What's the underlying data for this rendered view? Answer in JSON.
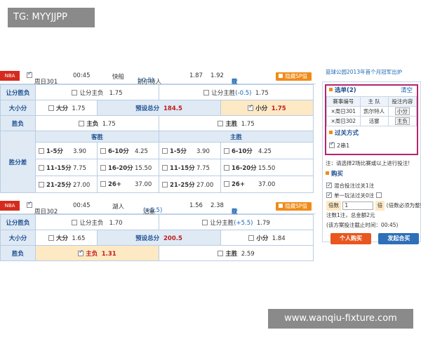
{
  "watermarks": {
    "top": "TG: MYYJJPP",
    "bottom": "www.wanqiu-fixture.com"
  },
  "game1": {
    "league": "NBA",
    "code": "周日301",
    "time": "00:45",
    "away": "快船",
    "home": "凯尔特人",
    "handicap": "(-0.5)",
    "odds1": "1.87",
    "odds2": "1.92",
    "analysis": "析",
    "stats": "欧",
    "trend": "亚",
    "hide_sp": "隐藏SP值",
    "rows": {
      "hcp_label": "让分胜负",
      "hcp_away": "让分主负",
      "hcp_away_odds": "1.75",
      "hcp_home": "让分主胜",
      "hcp_home_line": "(-0.5)",
      "hcp_home_odds": "1.75",
      "ou_label": "大小分",
      "big": "大分",
      "big_odds": "1.75",
      "preset": "预设总分",
      "preset_val": "184.5",
      "small": "小分",
      "small_odds": "1.75",
      "wl_label": "胜负",
      "home_loss": "主负",
      "home_loss_odds": "1.75",
      "home_win": "主胜",
      "home_win_odds": "1.75",
      "margin_label": "胜分差",
      "away_win": "客胜",
      "home_win_h": "主胜"
    },
    "margins": {
      "away": [
        [
          "1-5分",
          "3.90"
        ],
        [
          "6-10分",
          "4.25"
        ],
        [
          "11-15分",
          "7.75"
        ],
        [
          "16-20分",
          "15.50"
        ],
        [
          "21-25分",
          "27.00"
        ],
        [
          "26+",
          "37.00"
        ]
      ],
      "home": [
        [
          "1-5分",
          "3.90"
        ],
        [
          "6-10分",
          "4.25"
        ],
        [
          "11-15分",
          "7.75"
        ],
        [
          "16-20分",
          "15.50"
        ],
        [
          "21-25分",
          "27.00"
        ],
        [
          "26+",
          "37.00"
        ]
      ]
    }
  },
  "game2": {
    "league": "NBA",
    "code": "周日302",
    "time": "00:45",
    "away": "湖人",
    "home": "活塞",
    "handicap": "(+5.5)",
    "odds1": "1.56",
    "odds2": "2.38",
    "analysis": "析",
    "stats": "欧",
    "trend": "亚",
    "hide_sp": "隐藏SP值",
    "rows": {
      "hcp_label": "让分胜负",
      "hcp_away": "让分主负",
      "hcp_away_odds": "1.70",
      "hcp_home": "让分主胜",
      "hcp_home_line": "(+5.5)",
      "hcp_home_odds": "1.79",
      "ou_label": "大小分",
      "big": "大分",
      "big_odds": "1.65",
      "preset": "预设总分",
      "preset_val": "200.5",
      "small": "小分",
      "small_odds": "1.84",
      "wl_label": "胜负",
      "home_loss": "主负",
      "home_loss_odds": "1.31",
      "home_win": "主胜",
      "home_win_odds": "2.59"
    }
  },
  "slip": {
    "promo": "篮球公园2013年首个月冠军出炉",
    "title": "选单(2)",
    "clear": "清空",
    "cols": [
      "赛事编号",
      "主 队",
      "投注内容"
    ],
    "rows": [
      [
        "×周日301",
        "凯尔特人",
        "小分"
      ],
      [
        "×周日302",
        "活塞",
        "主负"
      ]
    ],
    "pass_title": "过关方式",
    "combo": "2串1",
    "tip": "注：请选择2场比赛或以上进行投注!",
    "buy_title": "购买",
    "mix": "混合投注过关1注",
    "single": "单一玩法过关0注",
    "mult_label": "倍数",
    "mult_val": "1",
    "mult_unit": "倍",
    "mult_hint": "(倍数必须为整数)",
    "total": "注数1注，总金额2元",
    "deadline": "(该方案投注截止时间：00:45)",
    "buy_btn": "个人购买",
    "group_btn": "发起合买"
  }
}
